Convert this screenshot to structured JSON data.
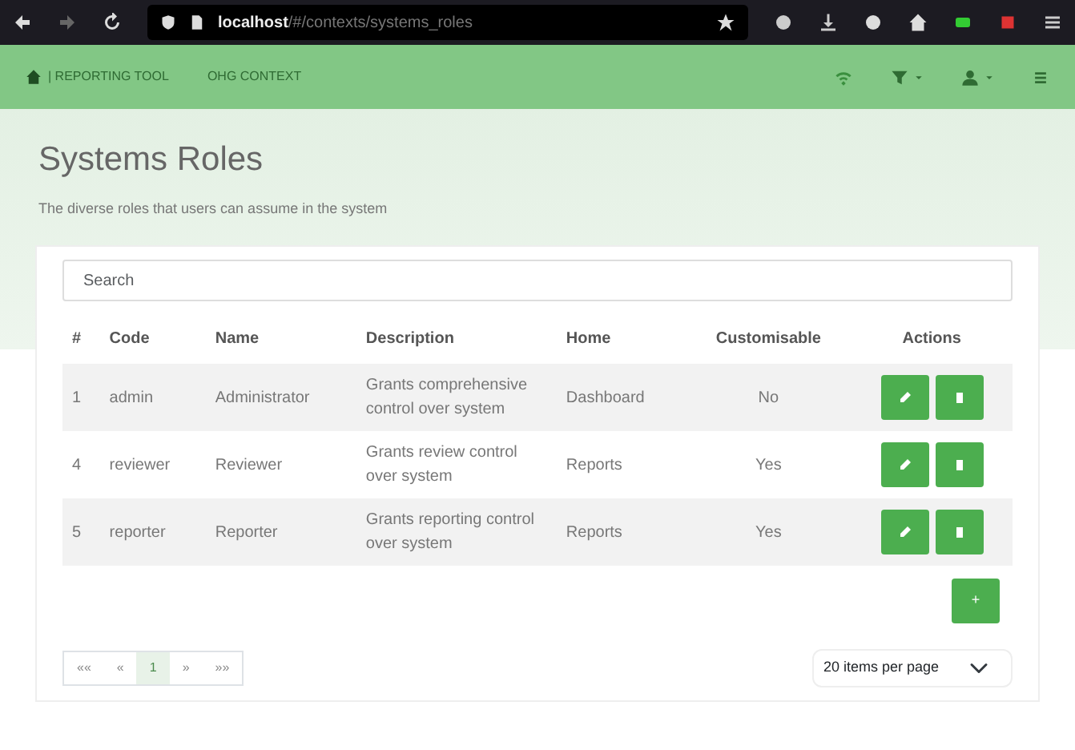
{
  "browser": {
    "url_host": "localhost",
    "url_path": "/#/contexts/systems_roles"
  },
  "navbar": {
    "brand": "| REPORTING TOOL",
    "links": [
      "OHG CONTEXT"
    ]
  },
  "page": {
    "title": "Systems Roles",
    "subtitle": "The diverse roles that users can assume in the system"
  },
  "search": {
    "placeholder": "Search"
  },
  "table": {
    "columns": [
      "#",
      "Code",
      "Name",
      "Description",
      "Home",
      "Customisable",
      "Actions"
    ],
    "rows": [
      {
        "id": "1",
        "code": "admin",
        "name": "Administrator",
        "description": "Grants comprehensive control over system",
        "home": "Dashboard",
        "customisable": "No"
      },
      {
        "id": "4",
        "code": "reviewer",
        "name": "Reviewer",
        "description": "Grants review control over system",
        "home": "Reports",
        "customisable": "Yes"
      },
      {
        "id": "5",
        "code": "reporter",
        "name": "Reporter",
        "description": "Grants reporting control over system",
        "home": "Reports",
        "customisable": "Yes"
      }
    ]
  },
  "add_button": "+",
  "pagination": [
    {
      "label": "««",
      "selected": false
    },
    {
      "label": "«",
      "selected": false
    },
    {
      "label": "1",
      "selected": true
    },
    {
      "label": "»",
      "selected": false
    },
    {
      "label": "»»",
      "selected": false
    }
  ],
  "page_size": {
    "value": "20 items per page"
  }
}
